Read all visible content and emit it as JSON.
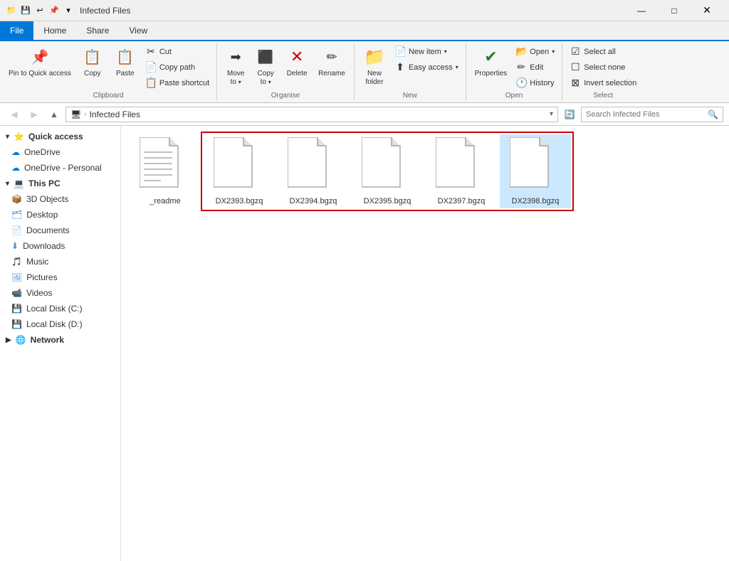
{
  "titlebar": {
    "title": "Infected Files",
    "icons": [
      "📁",
      "⬆",
      "🔒"
    ],
    "minimize": "—",
    "maximize": "□",
    "close": "✕"
  },
  "tabs": [
    {
      "label": "File",
      "active": true
    },
    {
      "label": "Home",
      "active": false
    },
    {
      "label": "Share",
      "active": false
    },
    {
      "label": "View",
      "active": false
    }
  ],
  "ribbon": {
    "clipboard": {
      "label": "Clipboard",
      "pin_label": "Pin to Quick\naccess",
      "copy_label": "Copy",
      "paste_label": "Paste",
      "cut": "Cut",
      "copy_path": "Copy path",
      "paste_shortcut": "Paste shortcut"
    },
    "organise": {
      "label": "Organise",
      "move_to": "Move\nto",
      "copy_to": "Copy\nto",
      "delete": "Delete",
      "rename": "Rename"
    },
    "new": {
      "label": "New",
      "new_folder": "New\nfolder",
      "new_item": "New item",
      "easy_access": "Easy access"
    },
    "open": {
      "label": "Open",
      "open": "Open",
      "edit": "Edit",
      "properties": "Properties",
      "history": "History"
    },
    "select": {
      "label": "Select",
      "select_all": "Select all",
      "select_none": "Select none",
      "invert": "Invert selection"
    }
  },
  "address": {
    "path": "Infected Files",
    "breadcrumb": [
      "",
      "Infected Files"
    ],
    "search_placeholder": "Search Infected Files"
  },
  "sidebar": {
    "items": [
      {
        "label": "Quick access",
        "icon": "⭐",
        "type": "header"
      },
      {
        "label": "OneDrive",
        "icon": "☁",
        "type": "item",
        "indent": true
      },
      {
        "label": "OneDrive - Personal",
        "icon": "☁",
        "type": "item",
        "indent": true
      },
      {
        "label": "This PC",
        "icon": "💻",
        "type": "header"
      },
      {
        "label": "3D Objects",
        "icon": "📦",
        "type": "item",
        "indent": true
      },
      {
        "label": "Desktop",
        "icon": "🗂",
        "type": "item",
        "indent": true
      },
      {
        "label": "Documents",
        "icon": "📄",
        "type": "item",
        "indent": true
      },
      {
        "label": "Downloads",
        "icon": "⬇",
        "type": "item",
        "indent": true
      },
      {
        "label": "Music",
        "icon": "🎵",
        "type": "item",
        "indent": true
      },
      {
        "label": "Pictures",
        "icon": "🖼",
        "type": "item",
        "indent": true
      },
      {
        "label": "Videos",
        "icon": "📹",
        "type": "item",
        "indent": true
      },
      {
        "label": "Local Disk (C:)",
        "icon": "💾",
        "type": "item",
        "indent": true
      },
      {
        "label": "Local Disk (D:)",
        "icon": "💾",
        "type": "item",
        "indent": true
      },
      {
        "label": "Network",
        "icon": "🌐",
        "type": "header"
      }
    ]
  },
  "files": [
    {
      "name": "_readme",
      "selected": false,
      "has_lines": true
    },
    {
      "name": "DX2393.bgzq",
      "selected": false,
      "boxed": true,
      "has_lines": false
    },
    {
      "name": "DX2394.bgzq",
      "selected": false,
      "boxed": true,
      "has_lines": false
    },
    {
      "name": "DX2395.bgzq",
      "selected": false,
      "boxed": true,
      "has_lines": false
    },
    {
      "name": "DX2397.bgzq",
      "selected": false,
      "boxed": true,
      "has_lines": false
    },
    {
      "name": "DX2398.bgzq",
      "selected": true,
      "boxed": true,
      "has_lines": false
    }
  ],
  "colors": {
    "accent": "#0078d7",
    "selection": "#cce8ff",
    "red_box": "#cc0000"
  }
}
